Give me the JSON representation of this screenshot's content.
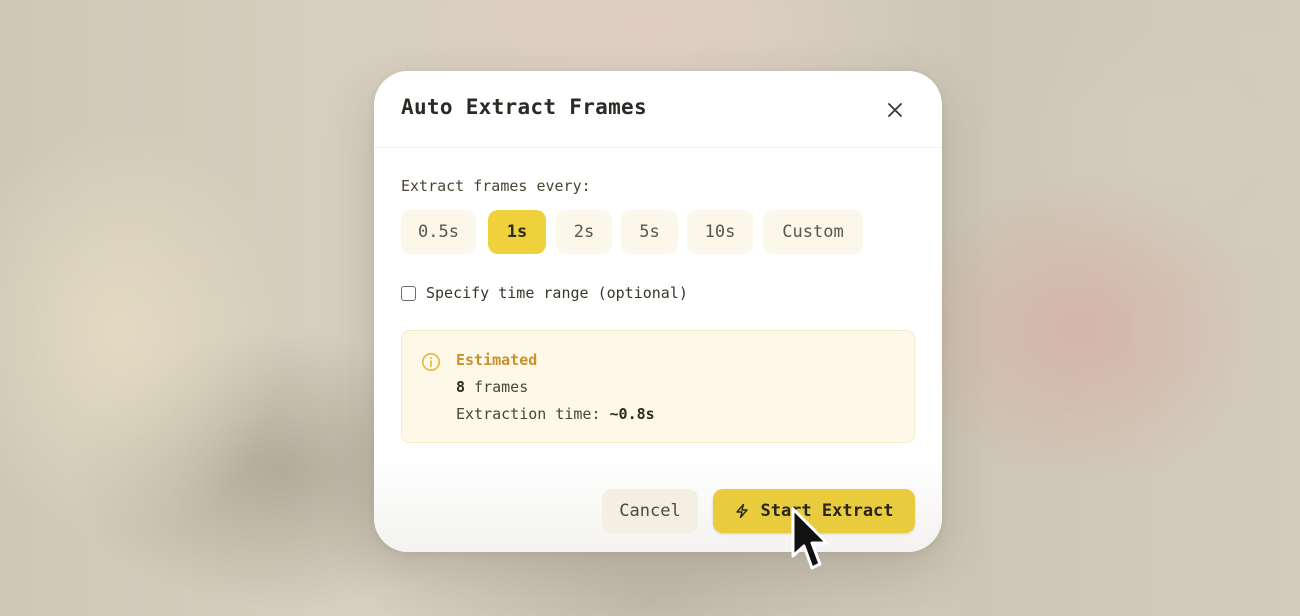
{
  "dialog": {
    "title": "Auto Extract Frames",
    "close_icon": "close-icon"
  },
  "interval": {
    "label": "Extract frames every:",
    "options": [
      "0.5s",
      "1s",
      "2s",
      "5s",
      "10s",
      "Custom"
    ],
    "selected": "1s"
  },
  "time_range": {
    "label": "Specify time range (optional)",
    "checked": false
  },
  "estimate": {
    "icon": "info-icon",
    "title": "Estimated",
    "frames_value": "8",
    "frames_suffix": " frames",
    "time_prefix": "Extraction time: ",
    "time_value": "~0.8s"
  },
  "actions": {
    "cancel_label": "Cancel",
    "start_label": "Start Extract",
    "start_icon": "lightning-bolt-icon"
  },
  "colors": {
    "accent": "#e9cc3e",
    "estimate_title": "#c8922b",
    "estimate_bg": "#fdf8e8"
  }
}
